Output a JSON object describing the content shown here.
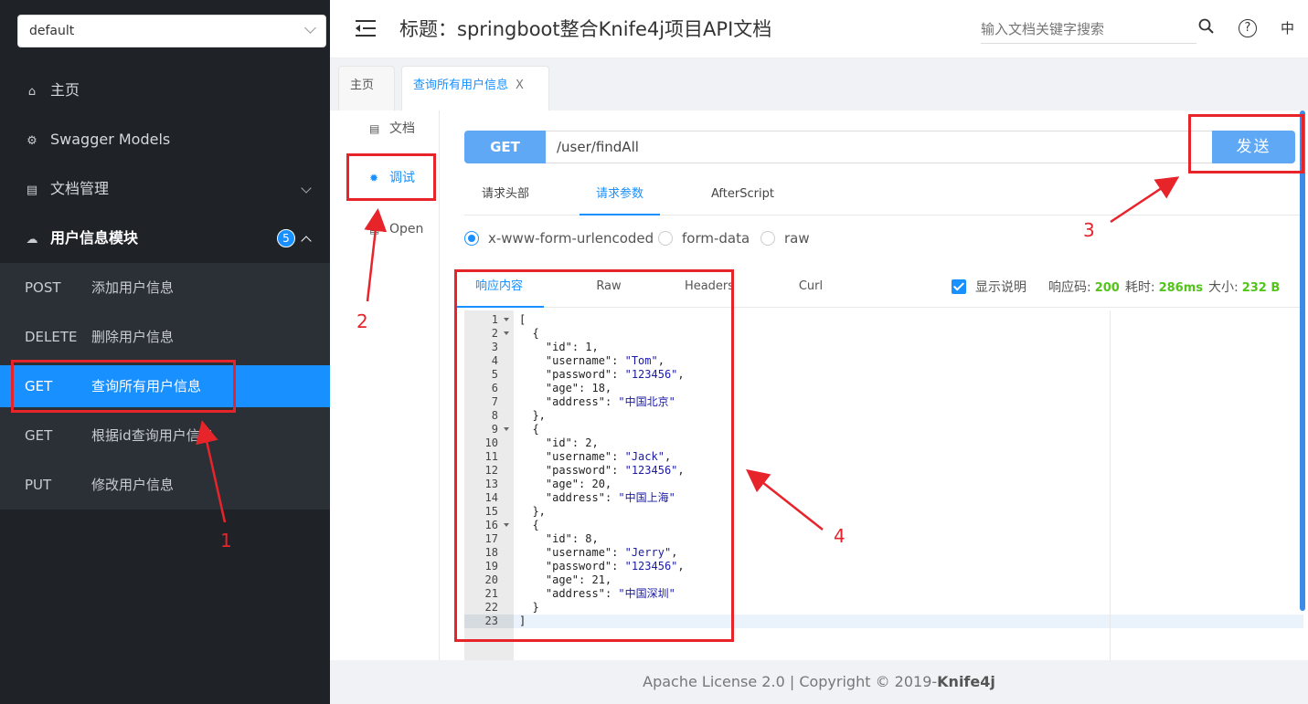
{
  "sidebar": {
    "group_select": "default",
    "nav": [
      {
        "icon": "home-icon",
        "label": "主页"
      },
      {
        "icon": "cube-icon",
        "label": "Swagger Models"
      },
      {
        "icon": "document-icon",
        "label": "文档管理"
      },
      {
        "icon": "cloud-icon",
        "label": "用户信息模块",
        "badge": "5"
      }
    ],
    "apis": [
      {
        "method": "POST",
        "label": "添加用户信息"
      },
      {
        "method": "DELETE",
        "label": "删除用户信息"
      },
      {
        "method": "GET",
        "label": "查询所有用户信息"
      },
      {
        "method": "GET",
        "label": "根据id查询用户信息"
      },
      {
        "method": "PUT",
        "label": "修改用户信息"
      }
    ]
  },
  "header": {
    "title": "标题：springboot整合Knife4j项目API文档",
    "search_placeholder": "输入文档关键字搜索",
    "help": "?",
    "lang": "中"
  },
  "tabs": [
    {
      "label": "主页"
    },
    {
      "label": "查询所有用户信息",
      "close": "X"
    }
  ],
  "side_tabs": [
    {
      "icon": "doc-icon",
      "label": "文档"
    },
    {
      "icon": "bug-icon",
      "label": "调试"
    },
    {
      "icon": "doc-icon",
      "label": "Open"
    }
  ],
  "request": {
    "method": "GET",
    "url": "/user/findAll",
    "send_label": "发送",
    "tabs": [
      "请求头部",
      "请求参数",
      "AfterScript"
    ],
    "body_types": [
      "x-www-form-urlencoded",
      "form-data",
      "raw"
    ]
  },
  "response": {
    "tabs": [
      "响应内容",
      "Raw",
      "Headers",
      "Curl"
    ],
    "show_desc": "显示说明",
    "code_label": "响应码:",
    "code": "200",
    "time_label": "耗时:",
    "time": "286ms",
    "size_label": "大小:",
    "size": "232 B"
  },
  "code_lines": [
    "[",
    "  {",
    "    \"id\": 1,",
    "    \"username\": \"Tom\",",
    "    \"password\": \"123456\",",
    "    \"age\": 18,",
    "    \"address\": \"中国北京\"",
    "  },",
    "  {",
    "    \"id\": 2,",
    "    \"username\": \"Jack\",",
    "    \"password\": \"123456\",",
    "    \"age\": 20,",
    "    \"address\": \"中国上海\"",
    "  },",
    "  {",
    "    \"id\": 8,",
    "    \"username\": \"Jerry\",",
    "    \"password\": \"123456\",",
    "    \"age\": 21,",
    "    \"address\": \"中国深圳\"",
    "  }",
    "]"
  ],
  "footer": {
    "text": "Apache License 2.0 | Copyright © 2019-",
    "brand": "Knife4j"
  },
  "annotations": [
    "1",
    "2",
    "3",
    "4"
  ],
  "colors": {
    "accent": "#1890ff",
    "annotation": "#e8242b",
    "sidebar": "#1f2328",
    "success": "#52c41a"
  }
}
